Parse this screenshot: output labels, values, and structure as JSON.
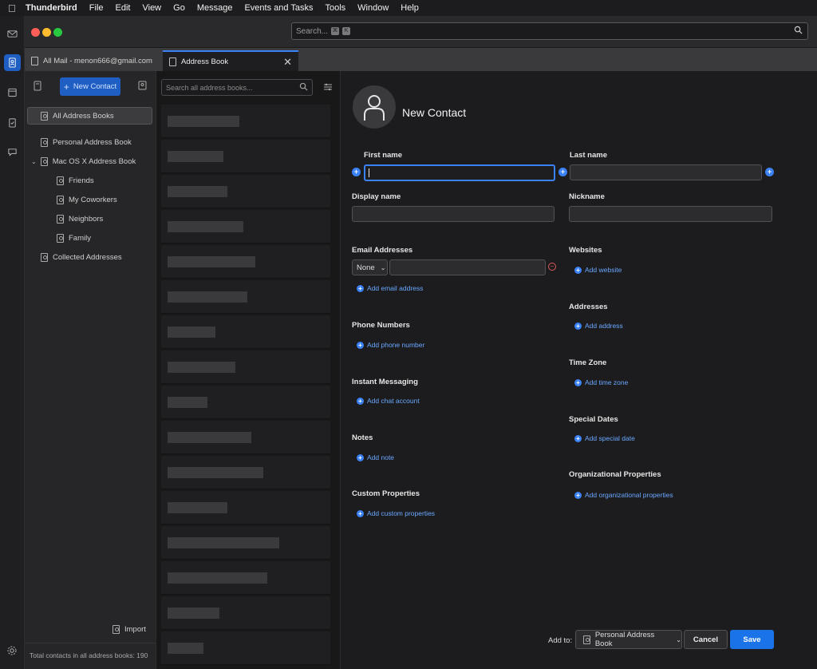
{
  "menubar": {
    "app": "Thunderbird",
    "items": [
      "File",
      "Edit",
      "View",
      "Go",
      "Message",
      "Events and Tasks",
      "Tools",
      "Window",
      "Help"
    ]
  },
  "search": {
    "placeholder": "Search...",
    "key1": "⌘",
    "key2": "K"
  },
  "tabs": [
    {
      "label": "All Mail - menon666@gmail.com"
    },
    {
      "label": "Address Book"
    }
  ],
  "sidebar": {
    "new_contact": "New Contact",
    "books": [
      {
        "label": "All Address Books"
      },
      {
        "label": "Personal Address Book"
      },
      {
        "label": "Mac OS X Address Book"
      },
      {
        "label": "Friends"
      },
      {
        "label": "My Coworkers"
      },
      {
        "label": "Neighbors"
      },
      {
        "label": "Family"
      },
      {
        "label": "Collected Addresses"
      }
    ],
    "import": "Import",
    "footer": "Total contacts in all address books: 190"
  },
  "list": {
    "search_placeholder": "Search all address books..."
  },
  "editor": {
    "title": "New Contact",
    "first_name_label": "First name",
    "last_name_label": "Last name",
    "display_name_label": "Display name",
    "nickname_label": "Nickname",
    "email_label": "Email Addresses",
    "email_type": "None",
    "add_email": "Add email address",
    "phone_label": "Phone Numbers",
    "add_phone": "Add phone number",
    "im_label": "Instant Messaging",
    "add_chat": "Add chat account",
    "notes_label": "Notes",
    "add_note": "Add note",
    "custom_label": "Custom Properties",
    "add_custom": "Add custom properties",
    "websites_label": "Websites",
    "add_website": "Add website",
    "addresses_label": "Addresses",
    "add_address": "Add address",
    "timezone_label": "Time Zone",
    "add_timezone": "Add time zone",
    "dates_label": "Special Dates",
    "add_date": "Add special date",
    "org_label": "Organizational Properties",
    "add_org": "Add organizational properties",
    "add_to_label": "Add to:",
    "add_to_value": "Personal Address Book",
    "cancel": "Cancel",
    "save": "Save"
  },
  "colors": {
    "accent": "#3b82f6",
    "save": "#1a73e8"
  }
}
